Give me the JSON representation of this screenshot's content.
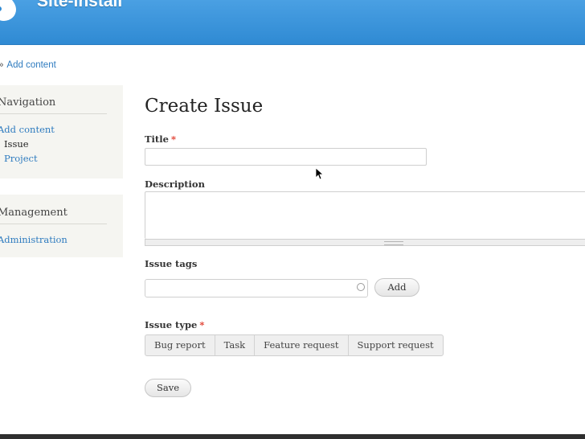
{
  "header": {
    "site_name": "Site-install",
    "background_color": "#3a95dc",
    "logo_icon": "drupal-drop-icon"
  },
  "breadcrumb": {
    "separator": "»",
    "current": "Add content"
  },
  "sidebar": {
    "navigation": {
      "title": "Navigation",
      "items": [
        {
          "label": "Add content"
        },
        {
          "label": "Issue"
        },
        {
          "label": "Project"
        }
      ]
    },
    "management": {
      "title": "Management",
      "items": [
        {
          "label": "Administration"
        }
      ]
    }
  },
  "main": {
    "page_title": "Create Issue",
    "required_marker": "*",
    "title_field": {
      "label": "Title",
      "value": ""
    },
    "description_field": {
      "label": "Description",
      "value": ""
    },
    "issue_tags_field": {
      "label": "Issue tags",
      "value": "",
      "add_label": "Add"
    },
    "issue_type_field": {
      "label": "Issue type",
      "options": [
        "Bug report",
        "Task",
        "Feature request",
        "Support request"
      ]
    },
    "save_label": "Save"
  },
  "colors": {
    "link": "#2e7bbf",
    "required": "#e03b2c"
  }
}
